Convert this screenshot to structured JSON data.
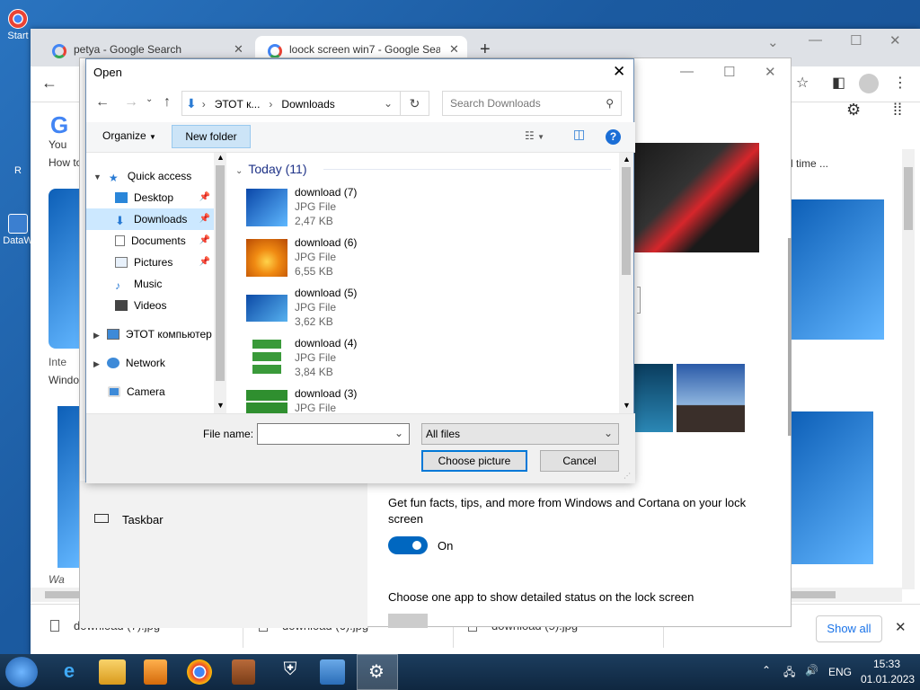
{
  "desktop": {
    "icons": [
      {
        "label": "Start"
      },
      {
        "label": "R"
      },
      {
        "label": "DataW"
      }
    ]
  },
  "chrome": {
    "tabs": [
      {
        "title": "petya - Google Search"
      },
      {
        "title": "loock screen win7 - Google Search"
      }
    ],
    "page": {
      "left_snippet_1": "You",
      "left_snippet_2": "How to",
      "left_caption": "Inte",
      "left_caption_2": "Windo",
      "left_bottom": "Wa",
      "right_snippet": "d time ..."
    },
    "downloads": [
      {
        "name": "download (7).jpg"
      },
      {
        "name": "download (6).jpg"
      },
      {
        "name": "download (5).jpg"
      }
    ],
    "show_all": "Show all"
  },
  "settings": {
    "sidebar_item": "Taskbar",
    "fun_facts": "Get fun facts, tips, and more from Windows and Cortana on your lock screen",
    "toggle_state": "On",
    "choose_app": "Choose one app to show detailed status on the lock screen"
  },
  "dialog": {
    "title": "Open",
    "breadcrumb": [
      "ЭТОТ к...",
      "Downloads"
    ],
    "search_placeholder": "Search Downloads",
    "organize": "Organize",
    "new_folder": "New folder",
    "nav": [
      {
        "label": "Quick access",
        "icon": "star-icon"
      },
      {
        "label": "Desktop",
        "icon": "desktop-icon",
        "pinned": true
      },
      {
        "label": "Downloads",
        "icon": "download-icon",
        "pinned": true,
        "selected": true
      },
      {
        "label": "Documents",
        "icon": "documents-icon",
        "pinned": true
      },
      {
        "label": "Pictures",
        "icon": "pictures-icon",
        "pinned": true
      },
      {
        "label": "Music",
        "icon": "music-icon"
      },
      {
        "label": "Videos",
        "icon": "videos-icon"
      },
      {
        "label": "ЭТОТ компьютер",
        "icon": "computer-icon"
      },
      {
        "label": "Network",
        "icon": "network-icon"
      },
      {
        "label": "Camera",
        "icon": "camera-icon"
      }
    ],
    "group_header": "Today (11)",
    "files": [
      {
        "name": "download (7)",
        "type": "JPG File",
        "size": "2,47 KB",
        "thumb": "#1f74d0"
      },
      {
        "name": "download (6)",
        "type": "JPG File",
        "size": "6,55 KB",
        "thumb": "#f08a12"
      },
      {
        "name": "download (5)",
        "type": "JPG File",
        "size": "3,62 KB",
        "thumb": "#2b86da"
      },
      {
        "name": "download (4)",
        "type": "JPG File",
        "size": "3,84 KB",
        "thumb": "#3a9a3a"
      },
      {
        "name": "download (3)",
        "type": "JPG File",
        "size": "",
        "thumb": "#2f8f2f"
      }
    ],
    "file_name_label": "File name:",
    "file_name_value": "",
    "filter": "All files",
    "choose": "Choose picture",
    "cancel": "Cancel"
  },
  "taskbar": {
    "language": "ENG",
    "time": "15:33",
    "date": "01.01.2023"
  }
}
